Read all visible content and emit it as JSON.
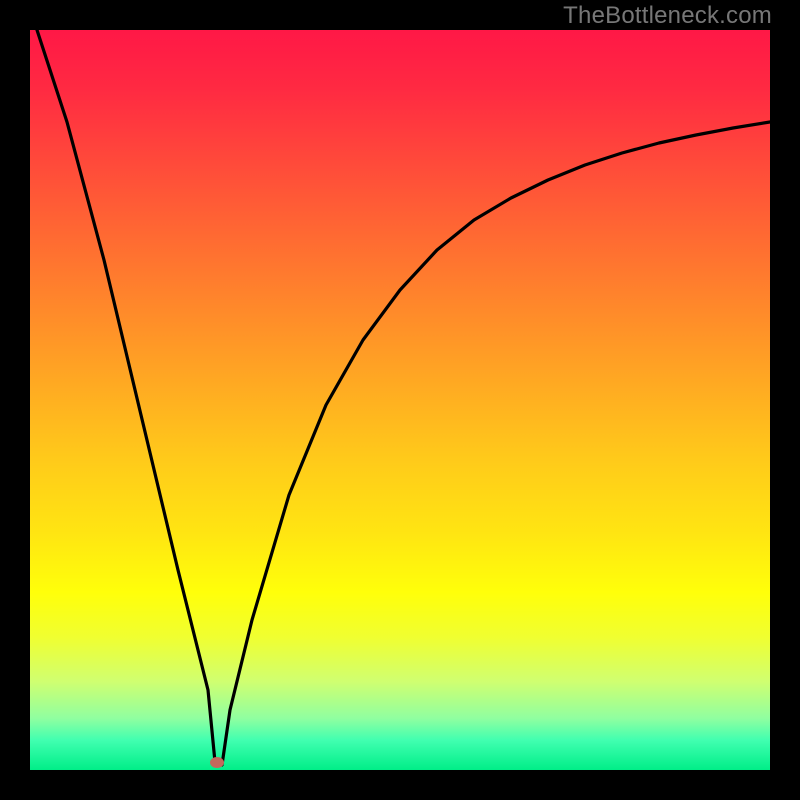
{
  "watermark": "TheBottleneck.com",
  "colors": {
    "gradient_top": "#ff1846",
    "gradient_bottom": "#00ee88",
    "curve": "#000000",
    "marker": "#c4695c",
    "frame": "#000000"
  },
  "chart_data": {
    "type": "line",
    "title": "",
    "xlabel": "",
    "ylabel": "",
    "xlim": [
      0,
      100
    ],
    "ylim": [
      0,
      100
    ],
    "annotations": {
      "watermark": "TheBottleneck.com",
      "marker": {
        "x": 25,
        "y": 0,
        "color": "#c4695c"
      }
    },
    "series": [
      {
        "name": "left-branch",
        "x": [
          1,
          5,
          10,
          15,
          20,
          24,
          25
        ],
        "y": [
          100,
          83,
          62,
          41,
          20,
          3,
          0
        ]
      },
      {
        "name": "right-branch",
        "x": [
          25,
          27,
          30,
          35,
          40,
          45,
          50,
          55,
          60,
          65,
          70,
          75,
          80,
          85,
          90,
          95,
          100
        ],
        "y": [
          0,
          8,
          20,
          37,
          49,
          58,
          65,
          70,
          74,
          77,
          80,
          82,
          84,
          85,
          86,
          87,
          88
        ]
      }
    ],
    "background_gradient": {
      "type": "vertical",
      "stops": [
        {
          "pos": 0.0,
          "color": "#ff1846"
        },
        {
          "pos": 0.5,
          "color": "#ffaa22"
        },
        {
          "pos": 0.76,
          "color": "#ffff0a"
        },
        {
          "pos": 1.0,
          "color": "#00ee88"
        }
      ]
    }
  }
}
